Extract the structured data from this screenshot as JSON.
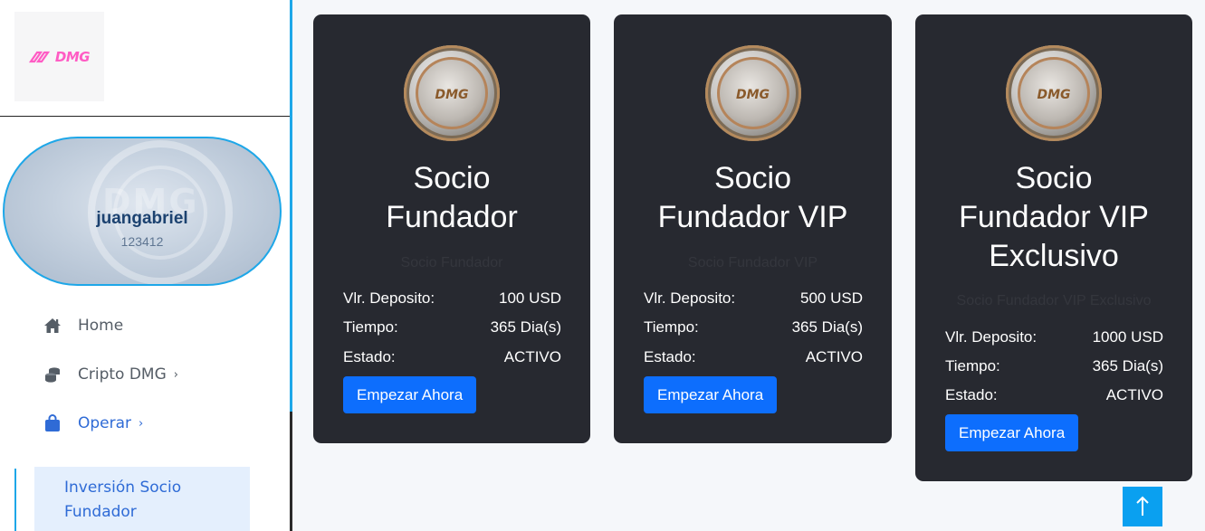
{
  "brand": {
    "logo_text": "DMG",
    "accent": "#ff5cc4"
  },
  "profile": {
    "username": "juangabriel",
    "user_id": "123412"
  },
  "nav": {
    "items": [
      {
        "label": "Home",
        "icon": "home-icon"
      },
      {
        "label": "Cripto DMG",
        "icon": "coins-icon",
        "chevron": "›"
      },
      {
        "label": "Operar",
        "icon": "shopping-bag-icon",
        "chevron": "›"
      }
    ],
    "submenu_active": "Inversión Socio Fundador"
  },
  "cards": [
    {
      "title": "Socio Fundador",
      "subtitle": "Socio Fundador",
      "deposit_label": "Vlr. Deposito:",
      "deposit_value": "100 USD",
      "time_label": "Tiempo:",
      "time_value": "365 Dia(s)",
      "status_label": "Estado:",
      "status_value": "ACTIVO",
      "button": "Empezar Ahora"
    },
    {
      "title": "Socio Fundador VIP",
      "subtitle": "Socio Fundador VIP",
      "deposit_label": "Vlr. Deposito:",
      "deposit_value": "500 USD",
      "time_label": "Tiempo:",
      "time_value": "365 Dia(s)",
      "status_label": "Estado:",
      "status_value": "ACTIVO",
      "button": "Empezar Ahora"
    },
    {
      "title": "Socio Fundador VIP Exclusivo",
      "subtitle": "Socio Fundador VIP Exclusivo",
      "deposit_label": "Vlr. Deposito:",
      "deposit_value": "1000 USD",
      "time_label": "Tiempo:",
      "time_value": "365 Dia(s)",
      "status_label": "Estado:",
      "status_value": "ACTIVO",
      "button": "Empezar Ahora"
    }
  ],
  "coin_badge": {
    "text": "DMG"
  },
  "scroll_top": {
    "icon": "arrow-up-icon"
  },
  "colors": {
    "primary": "#0d6efd",
    "card_bg": "#272930",
    "sidebar_accent": "#1ea7e8",
    "scroll_button": "#0aa0f0"
  }
}
